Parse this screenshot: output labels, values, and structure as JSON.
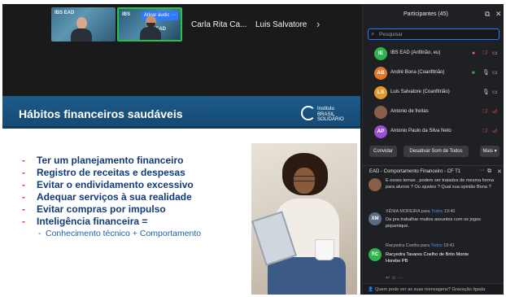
{
  "video_strip": {
    "thumb_1_logo": "IBS EAD",
    "thumb_2_logo_left": "IBS",
    "thumb_2_logo_right": "IBS EAD",
    "mute_badge": "Ativar áudio",
    "more_badge": "···",
    "tiles": [
      {
        "name": "Carla Rita Ca..."
      },
      {
        "name": "Luis Salvatore"
      }
    ],
    "next_icon": "›"
  },
  "slide": {
    "title": "Hábitos financeiros saudáveis",
    "logo_line1": "Instituto",
    "logo_line2": "BRASIL",
    "logo_line3": "SOLIDÁRIO",
    "bullets": [
      {
        "dash": "-",
        "text": "Ter um planejamento financeiro"
      },
      {
        "dash": "-",
        "text": "Registro de receitas e despesas"
      },
      {
        "dash": "-",
        "text": "Evitar o endividamento excessivo"
      },
      {
        "dash": "-",
        "text": "Adequar serviços à sua realidade"
      },
      {
        "dash": "-",
        "text": "Evitar compras por impulso"
      },
      {
        "dash": "-",
        "text": "Inteligência financeira ="
      }
    ],
    "sub_bullet": {
      "dash": "-",
      "text": "Conhecimento técnico + Comportamento"
    }
  },
  "participants": {
    "title": "Participantes (45)",
    "search_placeholder": "Pesquisar",
    "list": [
      {
        "initials": "IE",
        "name": "IBS EAD (Anfitrião, eu)",
        "avatar_color": "#2fb34f"
      },
      {
        "initials": "AB",
        "name": "André Bona (Coanfitrião)",
        "avatar_color": "#e0782a"
      },
      {
        "initials": "LS",
        "name": "Luis Salvatore (Coanfitrião)",
        "avatar_color": "#e39a2c"
      },
      {
        "initials": "",
        "name": "Antonio de freitas",
        "avatar_color": "#8a5c4a"
      },
      {
        "initials": "AP",
        "name": "Antonio Paulo da Silva Neto",
        "avatar_color": "#9c4fd1"
      }
    ],
    "buttons": {
      "invite": "Convidar",
      "unmute_all": "Desativar Som de Todos",
      "more": "Mais ▾"
    }
  },
  "chat": {
    "title": "EAD - Comportamento Financeiro - CF T1",
    "more_icon": "···",
    "messages": [
      {
        "type": "text",
        "text": "E esses temas , podem ser tratados de mesma forma para alunos ? Ou ajustes ? Qual sua opinião Bona ?"
      },
      {
        "type": "message",
        "initials": "XM",
        "sender": "XÊNIA MOREIRA",
        "to_word": "para",
        "to": "Todos",
        "time": "19:40",
        "text": "Da pra trabalhar muitos assuntos com os jogos piquenique.",
        "avatar_color": "#5b6b80"
      },
      {
        "type": "message",
        "initials": "RC",
        "sender": "Racyedra Coelho",
        "to_word": "para",
        "to": "Todos",
        "time": "19:41",
        "text": "Racyedra Tavares Coelho de Brito Monte Horebe PB",
        "avatar_color": "#2fb34f"
      }
    ],
    "reply_icons": "↩  ☺  ···",
    "footer_prefix": "Quem pode ver as suas mensagens?",
    "footer_suffix": "Gravação ligada"
  }
}
